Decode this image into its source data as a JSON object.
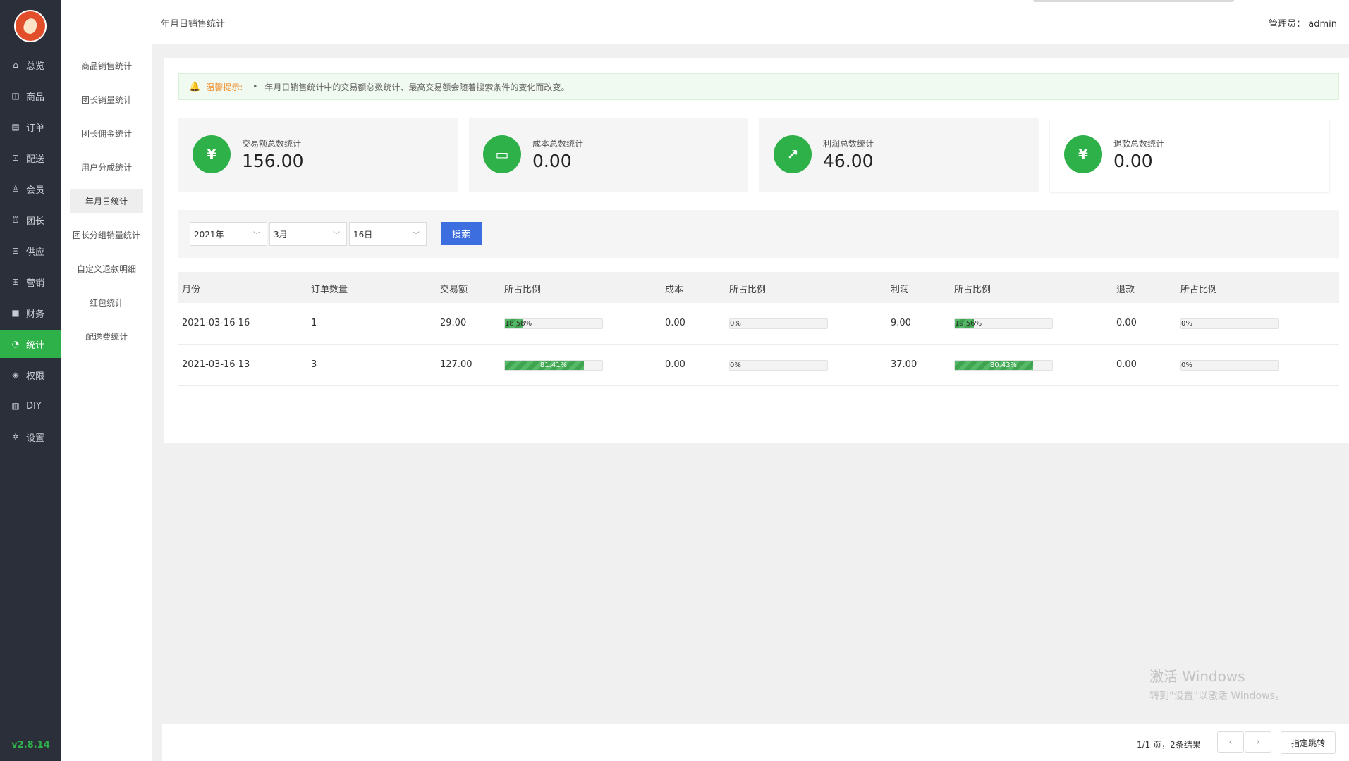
{
  "nav": {
    "version": "v2.8.14",
    "items": [
      {
        "label": "总览",
        "icon": "home-icon",
        "glyph": "⌂"
      },
      {
        "label": "商品",
        "icon": "bag-icon",
        "glyph": "◫"
      },
      {
        "label": "订单",
        "icon": "order-icon",
        "glyph": "▤"
      },
      {
        "label": "配送",
        "icon": "delivery-icon",
        "glyph": "⊡"
      },
      {
        "label": "会员",
        "icon": "user-icon",
        "glyph": "♙"
      },
      {
        "label": "团长",
        "icon": "leader-icon",
        "glyph": "♖"
      },
      {
        "label": "供应",
        "icon": "store-icon",
        "glyph": "⊟"
      },
      {
        "label": "营销",
        "icon": "gift-icon",
        "glyph": "⊞"
      },
      {
        "label": "财务",
        "icon": "wallet-icon",
        "glyph": "▣"
      },
      {
        "label": "统计",
        "icon": "chart-pie-icon",
        "glyph": "◔"
      },
      {
        "label": "权限",
        "icon": "shield-icon",
        "glyph": "◈"
      },
      {
        "label": "DIY",
        "icon": "layout-icon",
        "glyph": "▥"
      },
      {
        "label": "设置",
        "icon": "gear-icon",
        "glyph": "✲"
      }
    ]
  },
  "subnav": {
    "items": [
      "商品销售统计",
      "团长销量统计",
      "团长佣金统计",
      "用户分成统计",
      "年月日统计",
      "团长分组销量统计",
      "自定义退款明细",
      "红包统计",
      "配送费统计"
    ]
  },
  "header": {
    "title": "年月日销售统计",
    "admin": "管理员： admin"
  },
  "tip": {
    "label": "温馨提示:",
    "text": "年月日销售统计中的交易额总数统计、最高交易额会随着搜索条件的变化而改变。"
  },
  "cards": [
    {
      "label": "交易额总数统计",
      "value": "156.00",
      "icon": "money-shield-icon",
      "glyph": "¥"
    },
    {
      "label": "成本总数统计",
      "value": "0.00",
      "icon": "wallet-card-icon",
      "glyph": "▭"
    },
    {
      "label": "利润总数统计",
      "value": "46.00",
      "icon": "growth-chart-icon",
      "glyph": "↗"
    },
    {
      "label": "退款总数统计",
      "value": "0.00",
      "icon": "refund-coin-icon",
      "glyph": "¥"
    }
  ],
  "filter": {
    "year": "2021年",
    "month": "3月",
    "day": "16日",
    "search_label": "搜索"
  },
  "table": {
    "headers": [
      "月份",
      "订单数量",
      "交易额",
      "所占比例",
      "成本",
      "所占比例",
      "利润",
      "所占比例",
      "退款",
      "所占比例"
    ],
    "rows": [
      {
        "month": "2021-03-16 16",
        "orders": "1",
        "amount": "29.00",
        "amount_pct": "18.58%",
        "amount_ratio": 0.1858,
        "cost": "0.00",
        "cost_pct": "0%",
        "cost_ratio": 0,
        "profit": "9.00",
        "profit_pct": "19.56%",
        "profit_ratio": 0.1956,
        "refund": "0.00",
        "refund_pct": "0%",
        "refund_ratio": 0
      },
      {
        "month": "2021-03-16 13",
        "orders": "3",
        "amount": "127.00",
        "amount_pct": "81.41%",
        "amount_ratio": 0.8141,
        "cost": "0.00",
        "cost_pct": "0%",
        "cost_ratio": 0,
        "profit": "37.00",
        "profit_pct": "80.43%",
        "profit_ratio": 0.8043,
        "refund": "0.00",
        "refund_pct": "0%",
        "refund_ratio": 0
      }
    ]
  },
  "pager": {
    "info": "1/1 页，2条结果",
    "prev": "‹",
    "next": "›",
    "jump_label": "指定跳转"
  },
  "watermark": {
    "line1": "激活 Windows",
    "line2": "转到\"设置\"以激活 Windows。"
  }
}
